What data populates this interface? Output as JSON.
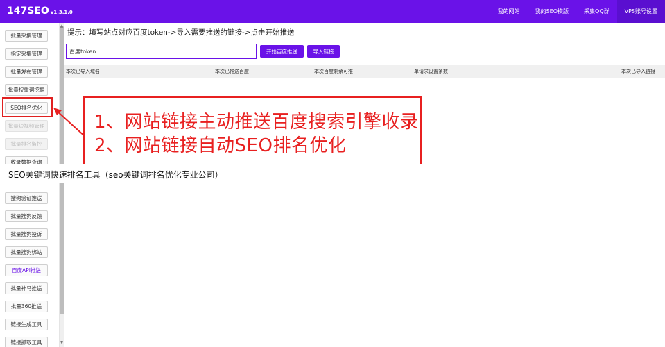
{
  "header": {
    "brand": "147SEO",
    "version": "v1.3.1.0",
    "nav": [
      {
        "label": "我的网站"
      },
      {
        "label": "我的SEO模版"
      },
      {
        "label": "采集QQ群"
      },
      {
        "label": "VPS账号设置"
      }
    ]
  },
  "sidebar": {
    "items": [
      {
        "label": "批量采集管理"
      },
      {
        "label": "指定采集管理"
      },
      {
        "label": "批量发布管理"
      },
      {
        "label": "批量权重词挖掘"
      },
      {
        "label": "SEO排名优化"
      },
      {
        "label": "批量短视频管理"
      },
      {
        "label": "批量排名监控"
      },
      {
        "label": "收录数据查询"
      },
      {
        "label": "搜狗验证推送"
      },
      {
        "label": "批量搜狗反馈"
      },
      {
        "label": "批量搜狗投诉"
      },
      {
        "label": "批量搜狗绑站"
      },
      {
        "label": "百度API推送"
      },
      {
        "label": "批量神马推送"
      },
      {
        "label": "批量360推送"
      },
      {
        "label": "链接生成工具"
      },
      {
        "label": "链接抓取工具"
      }
    ]
  },
  "main": {
    "hint": "提示：填写站点对应百度token->导入需要推送的链接->点击开始推送",
    "token_input": {
      "value": "百度token",
      "placeholder": "百度token"
    },
    "start_button": "开始百度推送",
    "import_button": "导入链接",
    "stats": [
      "本次已导入域名",
      "本次已推送百度",
      "本次百度剩余可推",
      "单请求设置条数",
      "本次已导入链接"
    ]
  },
  "callout": {
    "line1": "1、网站链接主动推送百度搜索引擎收录",
    "line2": "2、网站链接自动SEO排名优化"
  },
  "caption": "SEO关键词快速排名工具（seo关键词排名优化专业公司）",
  "colors": {
    "accent": "#6a12e8",
    "annotation": "#e82020"
  }
}
